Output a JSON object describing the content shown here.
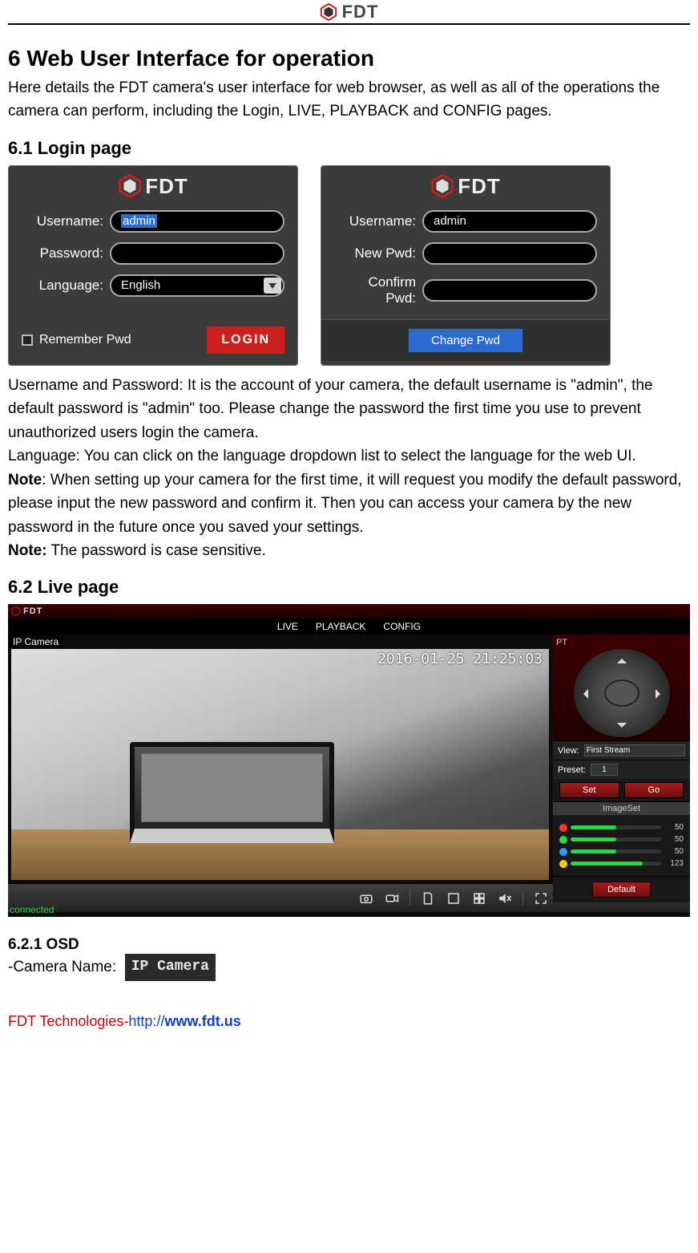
{
  "page_header": {
    "brand": "FDT"
  },
  "section6": {
    "title": "6 Web User Interface for operation",
    "intro": "Here details the FDT camera's user interface for web browser, as well as all of the operations the camera can perform, including the Login, LIVE, PLAYBACK and CONFIG pages."
  },
  "section61": {
    "title": "6.1 Login page",
    "login_panel": {
      "brand": "FDT",
      "username_label": "Username:",
      "username_value": "admin",
      "password_label": "Password:",
      "password_value": "",
      "language_label": "Language:",
      "language_value": "English",
      "remember_label": "Remember Pwd",
      "login_button": "LOGIN"
    },
    "change_panel": {
      "brand": "FDT",
      "username_label": "Username:",
      "username_value": "admin",
      "newpwd_label": "New Pwd:",
      "newpwd_value": "",
      "confirm_label": "Confirm Pwd:",
      "confirm_value": "",
      "change_button": "Change Pwd"
    },
    "para_userpass": "Username and Password: It is the account of your camera, the default username is \"admin\", the default password is \"admin\" too. Please change the password the first time you use to prevent unauthorized users login the camera.",
    "para_language": "Language: You can click on the language dropdown list to select the language for the web UI.",
    "note_label1": "Note",
    "note_text1": ": When setting up your camera for the first time, it will request you modify the default password, please input the new password and confirm it. Then you can access your camera by the new password in the future once you saved your settings.",
    "note_label2": "Note:",
    "note_text2": " The password is case sensitive."
  },
  "section62": {
    "title": "6.2 Live page",
    "live_ui": {
      "brand": "FDT",
      "tabs": {
        "live": "LIVE",
        "playback": "PLAYBACK",
        "config": "CONFIG"
      },
      "camera_name": "IP Camera",
      "timestamp": "2016-01-25 21:25:03",
      "connected": "connected",
      "pt_label": "PT",
      "view_label": "View:",
      "view_value": "First Stream",
      "preset_label": "Preset:",
      "preset_value": "1",
      "set_btn": "Set",
      "go_btn": "Go",
      "imageset_label": "ImageSet",
      "sliders": [
        {
          "color": "#ff3b30",
          "value": 50,
          "fill": 50
        },
        {
          "color": "#2bd648",
          "value": 50,
          "fill": 50
        },
        {
          "color": "#3399ff",
          "value": 50,
          "fill": 50
        },
        {
          "color": "#ffcc00",
          "value": 123,
          "fill": 80
        }
      ],
      "default_btn": "Default"
    }
  },
  "section621": {
    "title": "6.2.1 OSD",
    "camera_name_label": "-Camera Name:",
    "osd_value": "IP Camera"
  },
  "footer": {
    "company": "FDT Technologies-",
    "url_proto": "http://",
    "url_host": "www.fdt.us"
  }
}
